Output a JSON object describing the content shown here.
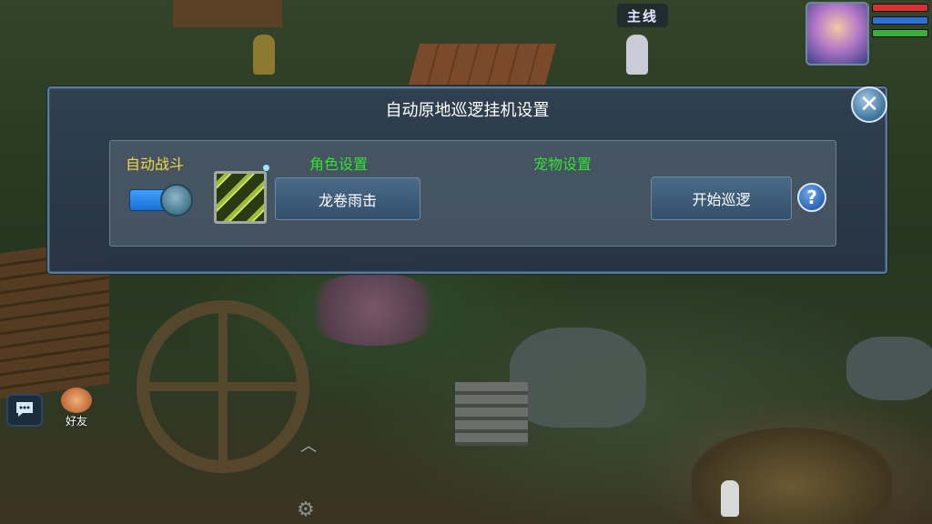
{
  "hud": {
    "main_quest_label": "主线",
    "friends_label": "好友"
  },
  "dialog": {
    "title": "自动原地巡逻挂机设置",
    "auto_battle_label": "自动战斗",
    "auto_battle_on": true,
    "role_settings_label": "角色设置",
    "selected_skill": "龙卷雨击",
    "pet_settings_label": "宠物设置",
    "start_button": "开始巡逻",
    "help_symbol": "?",
    "close_symbol": "✕"
  },
  "colors": {
    "title_text": "#ffffff",
    "auto_label": "#f3d74a",
    "section_label": "#33e233",
    "toggle_on": "#2f8cf0",
    "hp_bar": "#d83030",
    "mp_bar": "#2e6fd8",
    "exp_bar": "#3cae3c"
  },
  "icons": {
    "close": "close-icon",
    "help": "question-mark-icon",
    "chat": "chat-bubble-icon",
    "friends": "friends-icon",
    "settings": "gear-icon",
    "collapse": "chevron-up-icon",
    "skill": "tornado-rain-skill-icon"
  }
}
